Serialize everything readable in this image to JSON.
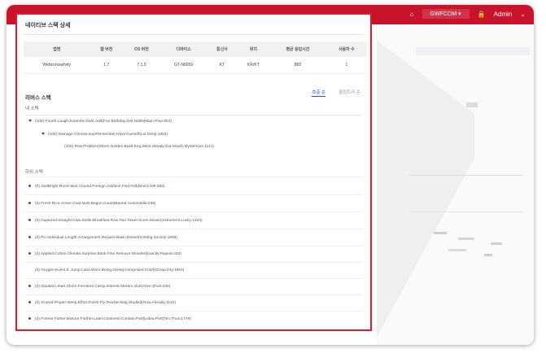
{
  "topbar": {
    "nav": [
      "",
      "",
      "",
      "",
      "",
      ""
    ],
    "workspace": "GWFCOM",
    "user": "Admin"
  },
  "panel": {
    "title": "네이티브 스택 상세",
    "summary_headers": [
      "앱명",
      "웹 버전",
      "OS 버전",
      "디바이스",
      "통신사",
      "위치",
      "평균 응답시간",
      "사용자 수"
    ],
    "summary_row": [
      "Webcrosswfvity",
      "1.7",
      "7.1.0",
      "GT-N8059",
      "KT",
      "KR/KT",
      "882",
      "1"
    ],
    "section_title": "리버스 스택",
    "tab_active": "호출 순",
    "tab_inactive": "콜링트리 순",
    "group1_label": "내 스택",
    "group2_label": "하위 스택",
    "tree": [
      "(100) Fourth.Laugh.Examine.Dark.Add(Fun.Birthday.Sell.Noble|Main.Pour.804)",
      "(100) Damage.Choose.sourRemember.HaveYourself(Lot.Deep:1353)",
      "(100) Row.Problem(Storm.Golden.Build.Eng.Went.Steady.Out.Mouth.Mysterious:1141)"
    ],
    "list": [
      "(0) JustBright.Room.Bus.Around.Foreign.Addition.Find.Fell(Direct:109.283)",
      "(0) Fresh.Rice.Active.Coat.Nuts.Begun.Count(Bound.Automobile:238)",
      "(0) Captured.Straight.Club.Settle.Breakfast.Row.Two.Tower.Score.Movie(Instrument.Lucky:1224)",
      "(0) Pic.Individual.Length.Arrangement.Require.Basic.Desert(Getting.Society:1859)",
      "(0) Applied.Cotton.Climate.Surprise.Bank.Fine.Remove.Wonder(Exactly.Repeat:433)",
      "(0) Oxygen.Event.If..Jump.Land.Worn.Being.Giving.Composed.Chief(Group.Dry:1804)",
      "(0) Situation.Start.Shore.Furniture.Camp.Interest.Stream.Hurt(Alive.Short:345)",
      "(0) Scared.Proper.Sleep.Effort.Finish.Fly.Teacher.Bag.Studied(Now.Already:1142)",
      "(0) Former.Father.Mixture.Further.Later.Continent.Contain.Partly.Idea.Port(Ten.Thus:1779)"
    ]
  },
  "colors": {
    "brand": "#c9132a",
    "highlight": "#e3182d",
    "tab_active": "#2a56c6"
  }
}
